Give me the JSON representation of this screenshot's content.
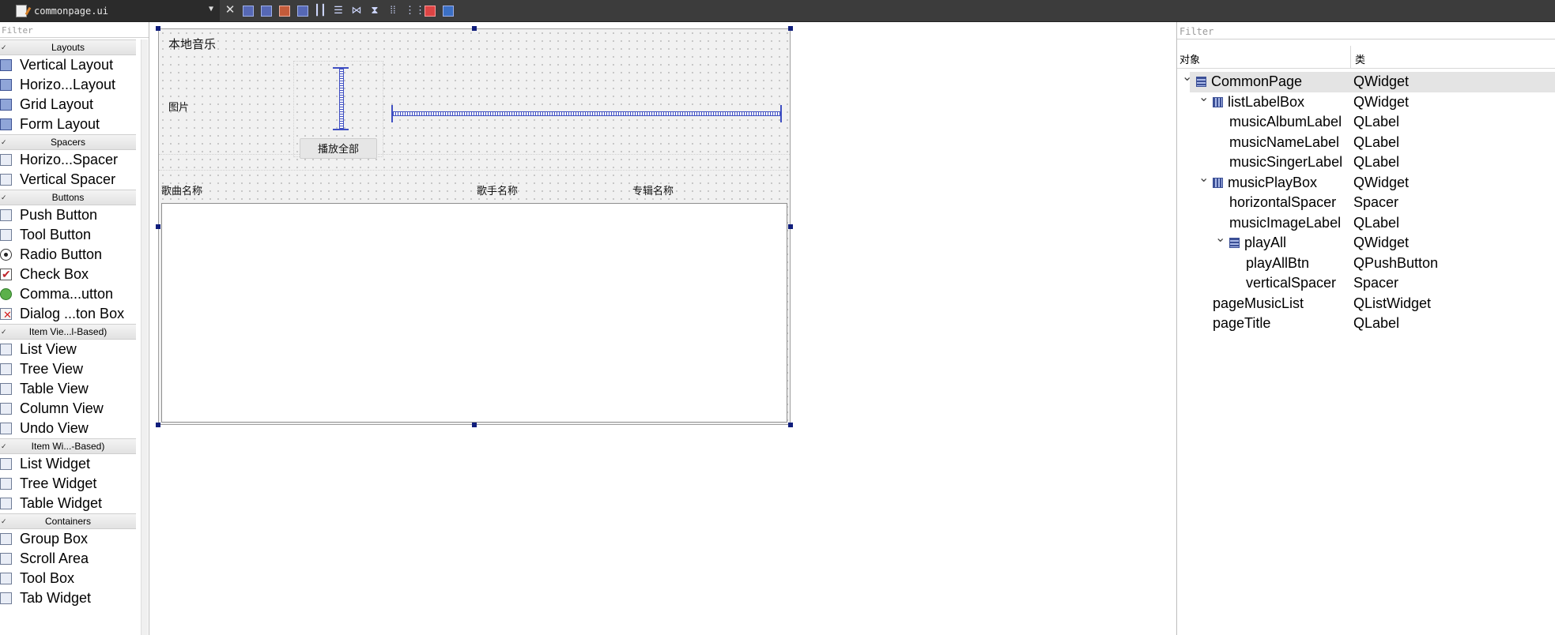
{
  "toolbar": {
    "file_name": "commonpage.ui",
    "icons": [
      "file-dropdown-icon",
      "close-form-icon",
      "send-backward-icon",
      "bring-forward-icon",
      "edit-signals-icon",
      "edit-buddies-icon",
      "layout-horizontal-icon",
      "layout-vertical-icon",
      "splitter-horizontal-icon",
      "splitter-vertical-icon",
      "layout-grid-icon",
      "layout-form-icon",
      "break-layout-icon",
      "adjust-size-icon"
    ]
  },
  "widget_box": {
    "filter_placeholder": "Filter",
    "categories": [
      {
        "title": "Layouts",
        "items": [
          {
            "label": "Vertical Layout",
            "icon": "vertical-layout-icon"
          },
          {
            "label": "Horizo...Layout",
            "icon": "horizontal-layout-icon"
          },
          {
            "label": "Grid Layout",
            "icon": "grid-layout-icon"
          },
          {
            "label": "Form Layout",
            "icon": "form-layout-icon"
          }
        ]
      },
      {
        "title": "Spacers",
        "items": [
          {
            "label": "Horizo...Spacer",
            "icon": "horizontal-spacer-icon"
          },
          {
            "label": "Vertical Spacer",
            "icon": "vertical-spacer-icon"
          }
        ]
      },
      {
        "title": "Buttons",
        "items": [
          {
            "label": "Push Button",
            "icon": "push-button-icon"
          },
          {
            "label": "Tool Button",
            "icon": "tool-button-icon"
          },
          {
            "label": "Radio Button",
            "icon": "radio-button-icon"
          },
          {
            "label": "Check Box",
            "icon": "check-box-icon"
          },
          {
            "label": "Comma...utton",
            "icon": "command-link-button-icon"
          },
          {
            "label": "Dialog ...ton Box",
            "icon": "dialog-button-box-icon"
          }
        ]
      },
      {
        "title": "Item Vie...l-Based)",
        "items": [
          {
            "label": "List View",
            "icon": "list-view-icon"
          },
          {
            "label": "Tree View",
            "icon": "tree-view-icon"
          },
          {
            "label": "Table View",
            "icon": "table-view-icon"
          },
          {
            "label": "Column View",
            "icon": "column-view-icon"
          },
          {
            "label": "Undo View",
            "icon": "undo-view-icon"
          }
        ]
      },
      {
        "title": "Item Wi...-Based)",
        "items": [
          {
            "label": "List Widget",
            "icon": "list-widget-icon"
          },
          {
            "label": "Tree Widget",
            "icon": "tree-widget-icon"
          },
          {
            "label": "Table Widget",
            "icon": "table-widget-icon"
          }
        ]
      },
      {
        "title": "Containers",
        "items": [
          {
            "label": "Group Box",
            "icon": "group-box-icon"
          },
          {
            "label": "Scroll Area",
            "icon": "scroll-area-icon"
          },
          {
            "label": "Tool Box",
            "icon": "tool-box-icon"
          },
          {
            "label": "Tab Widget",
            "icon": "tab-widget-icon"
          }
        ]
      }
    ]
  },
  "form": {
    "page_title": "本地音乐",
    "music_image_label": "图片",
    "play_all_button": "播放全部",
    "music_name_label": "歌曲名称",
    "music_singer_label": "歌手名称",
    "music_album_label": "专辑名称"
  },
  "object_inspector": {
    "filter_placeholder": "Filter",
    "col_object": "对象",
    "col_class": "类",
    "rows": [
      {
        "name": "CommonPage",
        "class": "QWidget",
        "level": 0,
        "expanded": true,
        "icon": "vertical-layout-icon",
        "selected": true
      },
      {
        "name": "listLabelBox",
        "class": "QWidget",
        "level": 1,
        "expanded": true,
        "icon": "horizontal-layout-icon"
      },
      {
        "name": "musicAlbumLabel",
        "class": "QLabel",
        "level": 2
      },
      {
        "name": "musicNameLabel",
        "class": "QLabel",
        "level": 2
      },
      {
        "name": "musicSingerLabel",
        "class": "QLabel",
        "level": 2
      },
      {
        "name": "musicPlayBox",
        "class": "QWidget",
        "level": 1,
        "expanded": true,
        "icon": "horizontal-layout-icon"
      },
      {
        "name": "horizontalSpacer",
        "class": "Spacer",
        "level": 2
      },
      {
        "name": "musicImageLabel",
        "class": "QLabel",
        "level": 2
      },
      {
        "name": "playAll",
        "class": "QWidget",
        "level": 2,
        "expanded": true,
        "icon": "vertical-layout-icon"
      },
      {
        "name": "playAllBtn",
        "class": "QPushButton",
        "level": 3
      },
      {
        "name": "verticalSpacer",
        "class": "Spacer",
        "level": 3
      },
      {
        "name": "pageMusicList",
        "class": "QListWidget",
        "level": 1
      },
      {
        "name": "pageTitle",
        "class": "QLabel",
        "level": 1
      }
    ]
  }
}
